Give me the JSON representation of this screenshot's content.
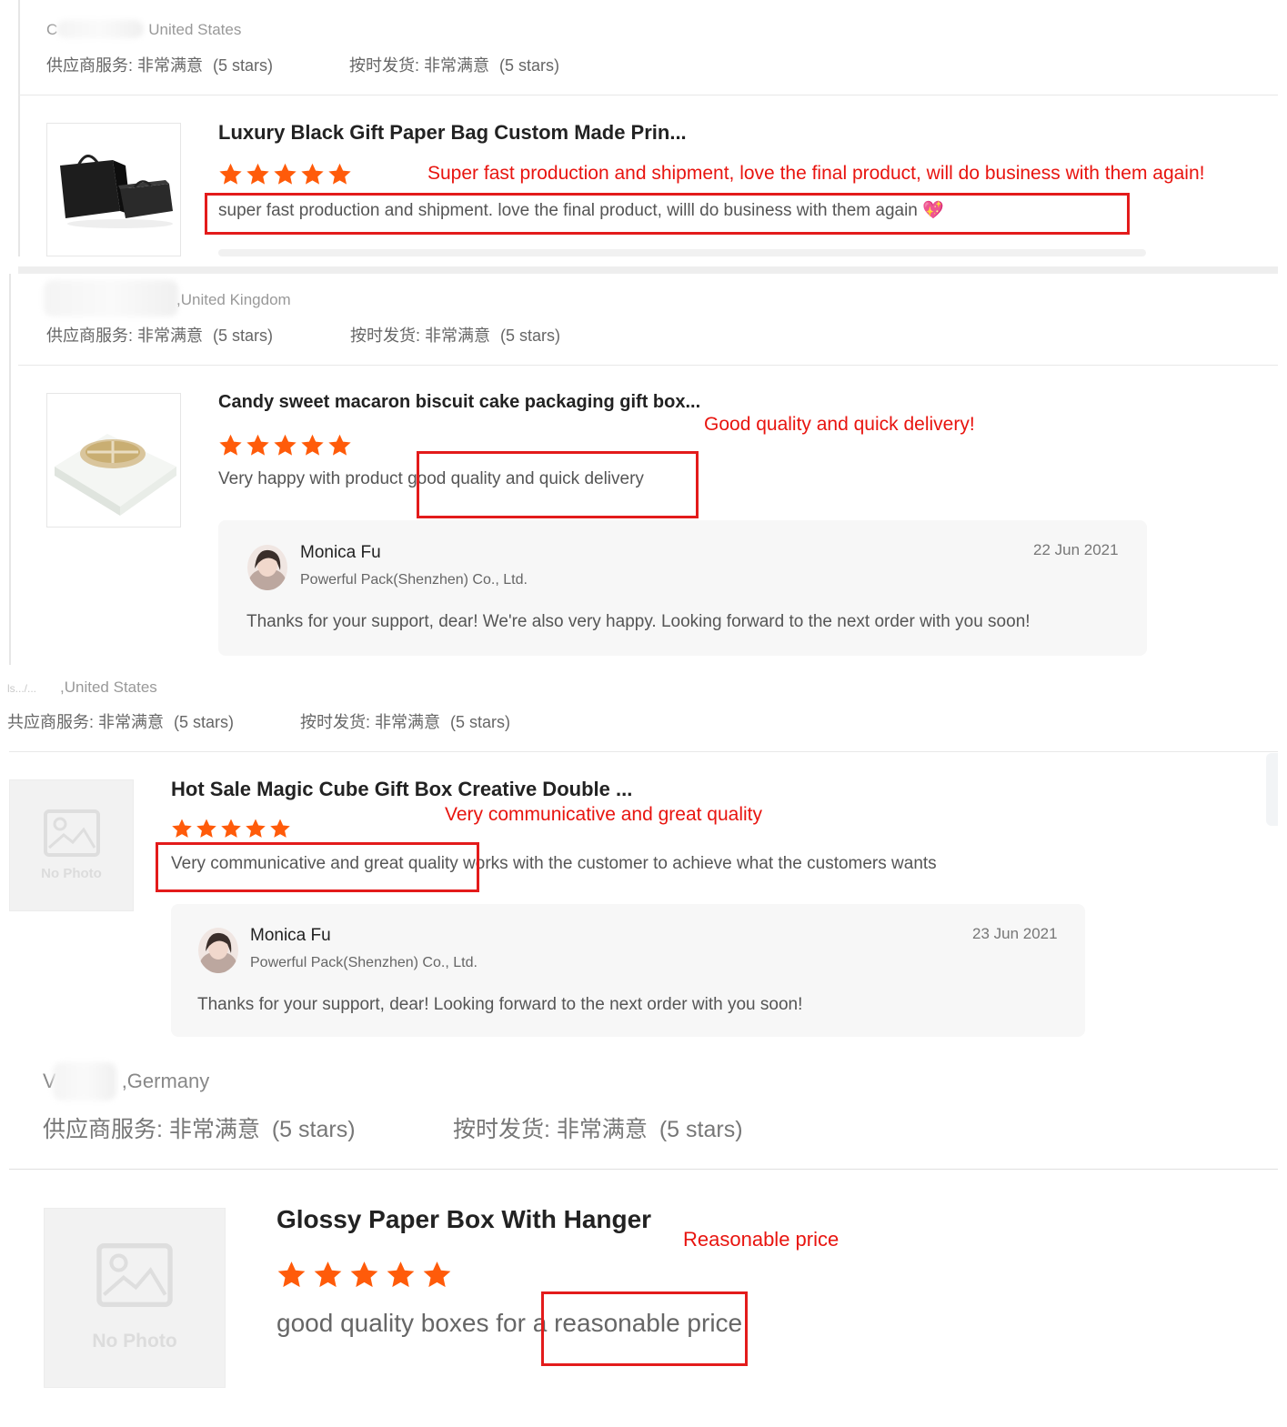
{
  "colors": {
    "star": "#ff5b0a",
    "annotation": "#e8140f",
    "box": "#e31b1b"
  },
  "reviews": [
    {
      "location": "United States",
      "location_prefix": "C",
      "supplier_service": "供应商服务: 非常满意",
      "supplier_service_stars": "(5 stars)",
      "on_time": "按时发货: 非常满意",
      "on_time_stars": "(5 stars)",
      "product_title": "Luxury Black Gift Paper Bag Custom Made Prin...",
      "image": "black-gift-bag-photo",
      "rating": 5,
      "text": "super fast production and shipment. love the final product, willl do business with them again 💖",
      "annotation": "Super fast production and shipment, love the final product, will do business with them again!"
    },
    {
      "location": ",United Kingdom",
      "supplier_service": "供应商服务: 非常满意",
      "supplier_service_stars": "(5 stars)",
      "on_time": "按时发货: 非常满意",
      "on_time_stars": "(5 stars)",
      "product_title": "Candy sweet macaron biscuit cake packaging gift box...",
      "image": "macaron-box-photo",
      "rating": 5,
      "text_a": "Very happy with product ",
      "text_b": "good quality and quick delivery",
      "annotation": "Good quality and quick delivery!",
      "reply": {
        "name": "Monica Fu",
        "company": "Powerful Pack(Shenzhen) Co., Ltd.",
        "date": "22 Jun 2021",
        "text": "Thanks for your support, dear!  We're also very happy. Looking forward to the next order with you soon!"
      }
    },
    {
      "location": ",United States",
      "location_prefix": "ls.../...",
      "supplier_service": "共应商服务: 非常满意",
      "supplier_service_stars": "(5 stars)",
      "on_time": "按时发货: 非常满意",
      "on_time_stars": "(5 stars)",
      "product_title": "Hot Sale Magic Cube Gift Box Creative Double ...",
      "image_label": "No Photo",
      "rating": 5,
      "text_a": "Very communicative and great quality",
      "text_b": " works with the customer to achieve what the customers wants",
      "annotation": "Very communicative and great quality",
      "reply": {
        "name": "Monica Fu",
        "company": "Powerful Pack(Shenzhen) Co., Ltd.",
        "date": "23 Jun 2021",
        "text": "Thanks for your support, dear!  Looking forward to the next order with you soon!"
      }
    },
    {
      "location": ",Germany",
      "location_prefix": "V",
      "supplier_service": "供应商服务: 非常满意",
      "supplier_service_stars": "(5 stars)",
      "on_time": "按时发货: 非常满意",
      "on_time_stars": "(5 stars)",
      "product_title": "Glossy Paper Box With Hanger",
      "image_label": "No Photo",
      "rating": 5,
      "text_a": "good quality boxes for a ",
      "text_b": "reasonable price",
      "annotation": "Reasonable price"
    }
  ]
}
